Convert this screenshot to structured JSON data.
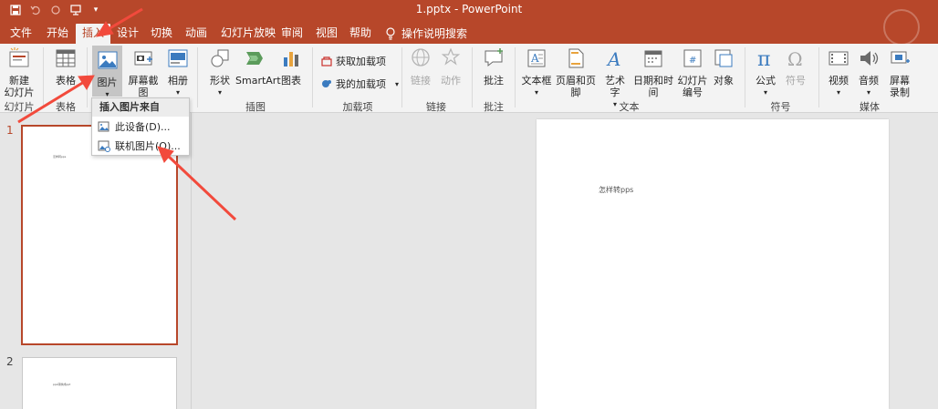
{
  "window": {
    "title": "1.pptx  -  PowerPoint"
  },
  "qat": {
    "save": "save-icon",
    "undo": "undo-icon",
    "redo": "redo-icon",
    "present": "present-icon",
    "more": "▾"
  },
  "tabs": [
    {
      "label": "文件"
    },
    {
      "label": "开始"
    },
    {
      "label": "插入"
    },
    {
      "label": "设计"
    },
    {
      "label": "切换"
    },
    {
      "label": "动画"
    },
    {
      "label": "幻灯片放映"
    },
    {
      "label": "审阅"
    },
    {
      "label": "视图"
    },
    {
      "label": "帮助"
    }
  ],
  "tell_me": "操作说明搜索",
  "ribbon": {
    "new_slide_line1": "新建",
    "new_slide_line2": "幻灯片",
    "table": "表格",
    "picture": "图片",
    "screenshot": "屏幕截图",
    "album": "相册",
    "shapes": "形状",
    "smartart": "SmartArt",
    "chart": "图表",
    "get_addins": "获取加载项",
    "my_addins": "我的加载项",
    "link": "链接",
    "action": "动作",
    "comment": "批注",
    "textbox": "文本框",
    "header_footer": "页眉和页脚",
    "wordart": "艺术字",
    "datetime": "日期和时间",
    "slide_number_line1": "幻灯片",
    "slide_number_line2": "编号",
    "object": "对象",
    "equation": "公式",
    "symbol": "符号",
    "video": "视频",
    "audio": "音频",
    "screen_record_line1": "屏幕",
    "screen_record_line2": "录制",
    "groups": {
      "slides": "幻灯片",
      "tables": "表格",
      "illustrations": "插图",
      "addins": "加载项",
      "links": "链接",
      "comments": "批注",
      "text": "文本",
      "symbols": "符号",
      "media": "媒体"
    }
  },
  "dropdown": {
    "header": "插入图片来自",
    "items": [
      {
        "label": "此设备(D)..."
      },
      {
        "label": "联机图片(O)..."
      }
    ]
  },
  "slides": [
    {
      "number": "1",
      "text": "怎样转pps"
    },
    {
      "number": "2",
      "text": "pps转换成ppt"
    }
  ],
  "main_slide": {
    "text": "怎样转pps"
  },
  "colors": {
    "accent": "#b7472a",
    "ribbon": "#f3f3f3",
    "arrow": "#f24a3c"
  }
}
